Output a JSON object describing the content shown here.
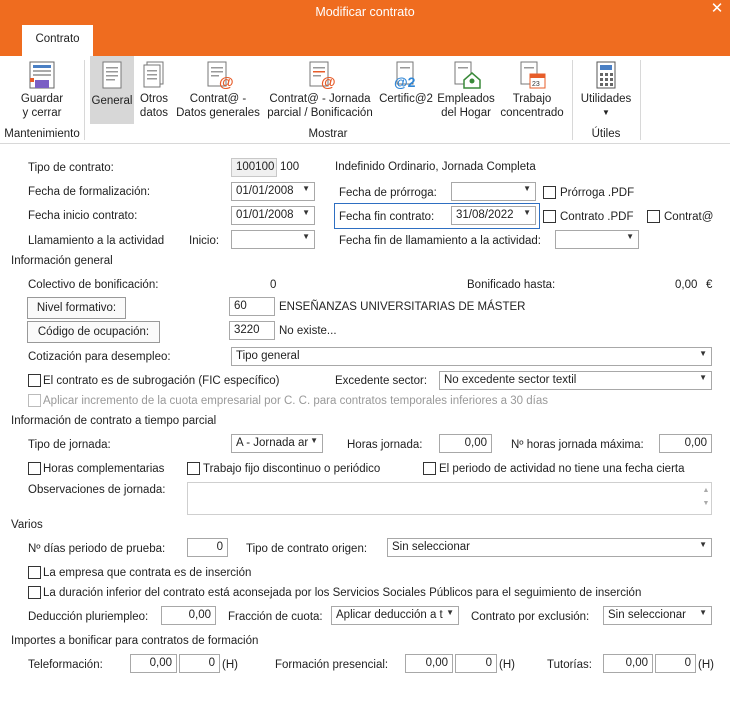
{
  "window": {
    "title": "Modificar contrato",
    "close": "✕"
  },
  "tabs": {
    "contrato": "Contrato"
  },
  "ribbon": {
    "guardar": {
      "l1": "Guardar",
      "l2": "y cerrar"
    },
    "general": "General",
    "otros": {
      "l1": "Otros",
      "l2": "datos"
    },
    "contrata_gen": {
      "l1": "Contrat@ -",
      "l2": "Datos generales"
    },
    "contrata_jor": {
      "l1": "Contrat@ - Jornada",
      "l2": "parcial / Bonificación"
    },
    "certifica": "Certific@2",
    "empleados": {
      "l1": "Empleados",
      "l2": "del Hogar"
    },
    "trabajo": {
      "l1": "Trabajo",
      "l2": "concentrado"
    },
    "utilidades": "Utilidades",
    "groups": {
      "mant": "Mantenimiento",
      "mostrar": "Mostrar",
      "utiles": "Útiles"
    }
  },
  "form": {
    "tipo_contrato_label": "Tipo de contrato:",
    "tipo_contrato_code": "100100",
    "tipo_contrato_num": "100",
    "tipo_contrato_desc": "Indefinido Ordinario, Jornada Completa",
    "fecha_form_label": "Fecha de formalización:",
    "fecha_form": "01/01/2008",
    "fecha_prorroga_label": "Fecha de prórroga:",
    "fecha_prorroga": "",
    "prorroga_pdf": "Prórroga .PDF",
    "fecha_inicio_label": "Fecha inicio contrato:",
    "fecha_inicio": "01/01/2008",
    "fecha_fin_label": "Fecha fin contrato:",
    "fecha_fin": "31/08/2022",
    "contrato_pdf": "Contrato .PDF",
    "contrata_chk": "Contrat@",
    "llamamiento_label": "Llamamiento a la actividad",
    "inicio_label": "Inicio:",
    "llam_inicio": "",
    "fecha_fin_llam_label": "Fecha fin de llamamiento a la actividad:",
    "fecha_fin_llam": ""
  },
  "general": {
    "section": "Información general",
    "colectivo_label": "Colectivo de bonificación:",
    "colectivo_val": "0",
    "bonificado_label": "Bonificado hasta:",
    "bonificado_val": "0,00",
    "euro": "€",
    "nivel_btn": "Nivel formativo:",
    "nivel_code": "60",
    "nivel_desc": "ENSEÑANZAS UNIVERSITARIAS DE MÁSTER",
    "ocup_btn": "Código de ocupación:",
    "ocup_code": "3220",
    "ocup_desc": "No existe...",
    "cotizacion_label": "Cotización para desempleo:",
    "cotizacion_val": "Tipo general",
    "subrogacion": "El contrato es de subrogación (FIC específico)",
    "excedente_label": "Excedente sector:",
    "excedente_val": "No excedente sector textil",
    "incremento": "Aplicar incremento de la cuota empresarial por C. C. para contratos temporales inferiores a 30 días"
  },
  "parcial": {
    "section": "Información de contrato a tiempo parcial",
    "tipo_jornada_label": "Tipo de jornada:",
    "tipo_jornada_val": "A - Jornada ar",
    "horas_label": "Horas jornada:",
    "horas_val": "0,00",
    "horas_max_label": "Nº horas jornada máxima:",
    "horas_max_val": "0,00",
    "horas_comp": "Horas complementarias",
    "trabajo_fijo": "Trabajo fijo discontinuo o periódico",
    "periodo": "El periodo de actividad no tiene una fecha cierta",
    "obs_label": "Observaciones de jornada:"
  },
  "varios": {
    "section": "Varios",
    "dias_label": "Nº días periodo de prueba:",
    "dias_val": "0",
    "origen_label": "Tipo de contrato origen:",
    "origen_val": "Sin seleccionar",
    "insercion": "La empresa que contrata es de inserción",
    "duracion": "La duración inferior del contrato está aconsejada por los Servicios Sociales Públicos para el seguimiento de inserción",
    "deduccion_label": "Deducción pluriempleo:",
    "deduccion_val": "0,00",
    "fraccion_label": "Fracción de cuota:",
    "fraccion_val": "Aplicar deducción a t",
    "exclusion_label": "Contrato por exclusión:",
    "exclusion_val": "Sin seleccionar"
  },
  "formacion": {
    "section": "Importes a bonificar para contratos de formación",
    "tele_label": "Teleformación:",
    "tele_val": "0,00",
    "tele_h": "0",
    "pres_label": "Formación presencial:",
    "pres_val": "0,00",
    "pres_h": "0",
    "tut_label": "Tutorías:",
    "tut_val": "0,00",
    "tut_h": "0",
    "h": "(H)"
  },
  "colors": {
    "accent": "#ef6c1f"
  }
}
